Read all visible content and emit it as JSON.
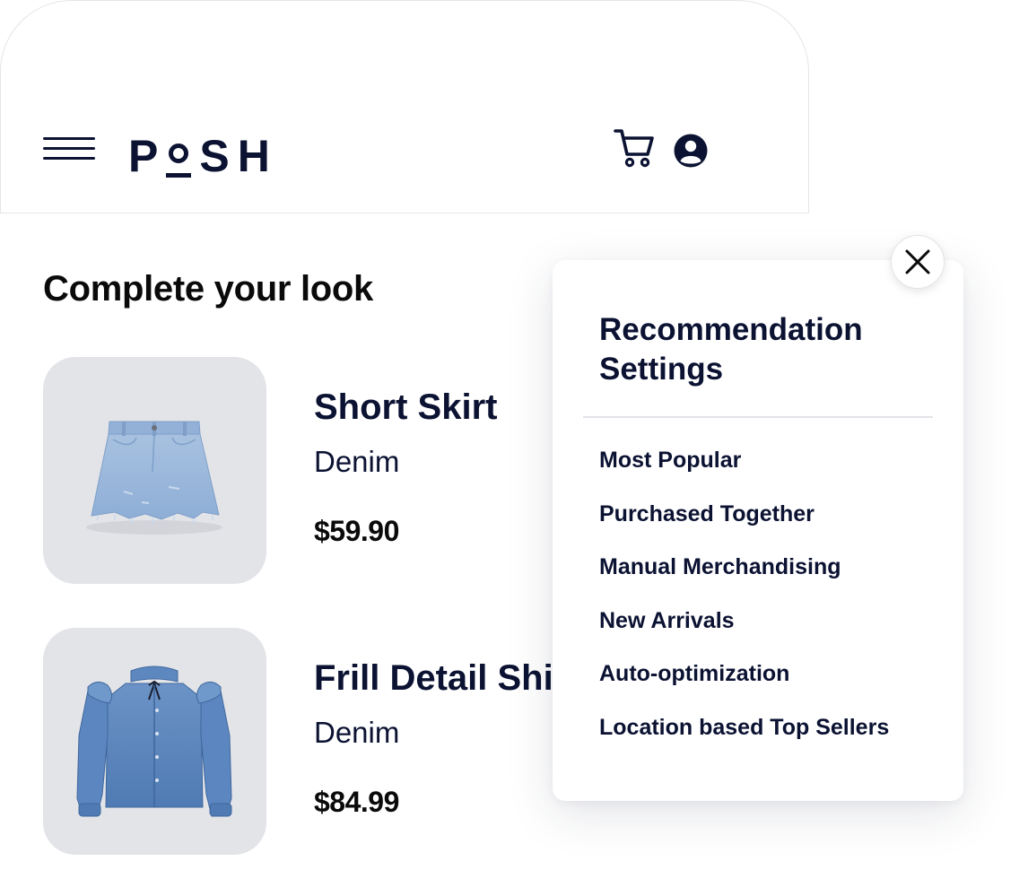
{
  "header": {
    "brand": [
      "P",
      "S",
      "H"
    ],
    "menu_icon": "hamburger-icon",
    "cart_icon": "shopping-cart-icon",
    "account_icon": "user-circle-icon"
  },
  "section": {
    "title": "Complete your look"
  },
  "products": [
    {
      "name": "Short Skirt",
      "material": "Denim",
      "price": "$59.90",
      "image": "denim-skirt-image"
    },
    {
      "name": "Frill Detail Shi",
      "material": "Denim",
      "price": "$84.99",
      "image": "denim-shirt-image"
    }
  ],
  "popover": {
    "title": "Recommendation Settings",
    "options": [
      "Most Popular",
      "Purchased Together",
      "Manual Merchandising",
      "New Arrivals",
      "Auto-optimization",
      "Location based Top Sellers"
    ],
    "close_icon": "close-icon"
  },
  "colors": {
    "navy": "#0b1232",
    "thumb_bg": "#e3e4e8",
    "denim_light": "#9bb7d9",
    "denim_mid": "#5b86bf"
  }
}
